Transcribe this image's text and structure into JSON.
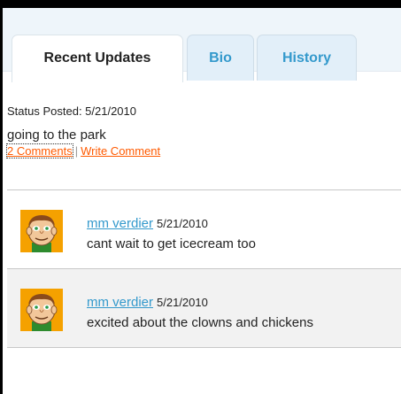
{
  "tabs": [
    {
      "label": "Recent Updates",
      "active": true
    },
    {
      "label": "Bio",
      "active": false
    },
    {
      "label": "History",
      "active": false
    }
  ],
  "status": {
    "posted_label": "Status Posted: 5/21/2010",
    "text": "going to the park",
    "comments_link": "2 Comments",
    "separator": "|",
    "write_comment_link": "Write Comment"
  },
  "comments": [
    {
      "author": "mm verdier",
      "date": "5/21/2010",
      "text": "cant wait to get icecream too"
    },
    {
      "author": "mm verdier",
      "date": "5/21/2010",
      "text": "excited about the clowns and chickens"
    }
  ],
  "colors": {
    "link_blue": "#3399cc",
    "action_orange": "#ff5a00",
    "tab_bg": "#e2eff9",
    "avatar_bg": "#f5a100"
  },
  "icons": {
    "avatar": "cartoon-face-avatar-icon"
  }
}
